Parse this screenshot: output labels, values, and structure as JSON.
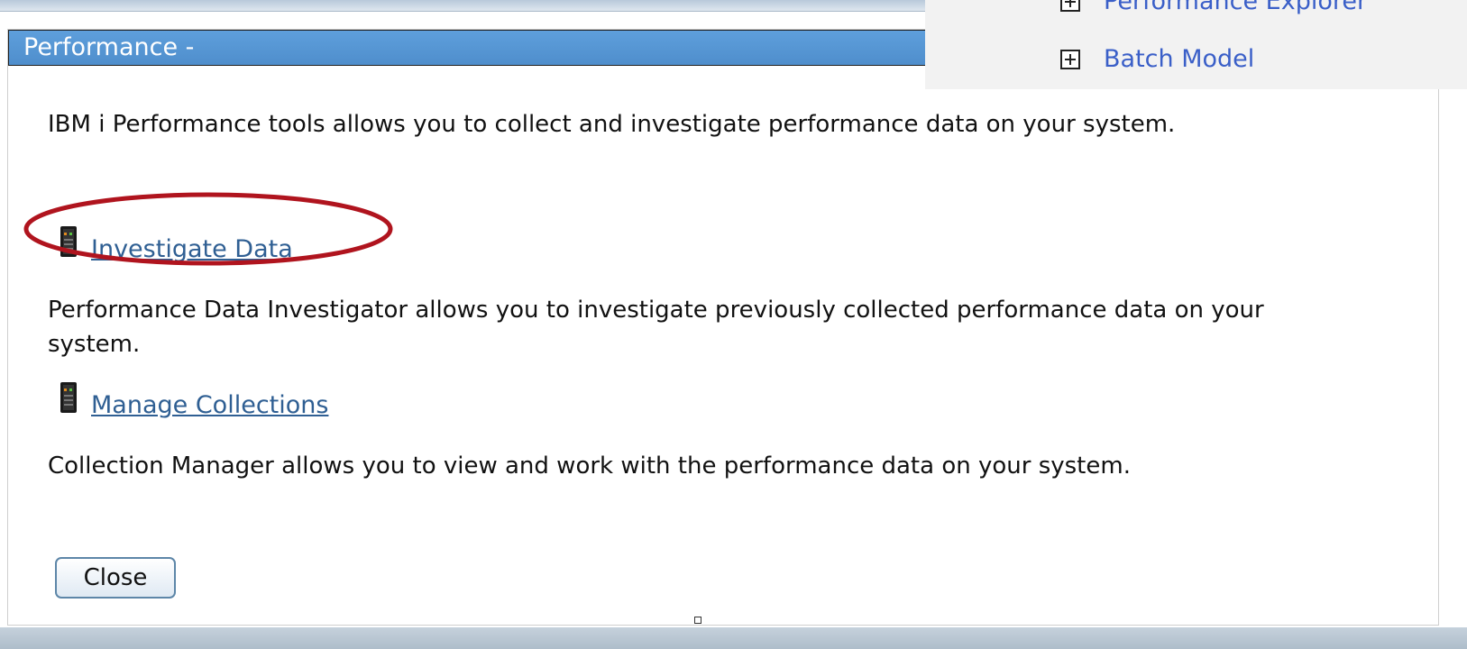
{
  "dialog": {
    "title": "Performance -",
    "intro": "IBM i Performance tools allows you to collect and investigate performance data on your system.",
    "links": [
      {
        "label": "Investigate Data",
        "icon": "server-icon",
        "description": "Performance Data Investigator allows you to investigate previously collected performance data on your system."
      },
      {
        "label": "Manage Collections",
        "icon": "server-icon",
        "description": "Collection Manager allows you to view and work with the performance data on your system."
      }
    ],
    "close_label": "Close"
  },
  "nav_panel": {
    "items": [
      {
        "label": "Performance Explorer",
        "icon": "expand-icon"
      },
      {
        "label": "Batch Model",
        "icon": "expand-icon"
      }
    ]
  },
  "colors": {
    "title_bar": "#5b9bd5",
    "link": "#2f5f93",
    "nav_link": "#3a5fc8",
    "highlight": "#b0141e"
  }
}
